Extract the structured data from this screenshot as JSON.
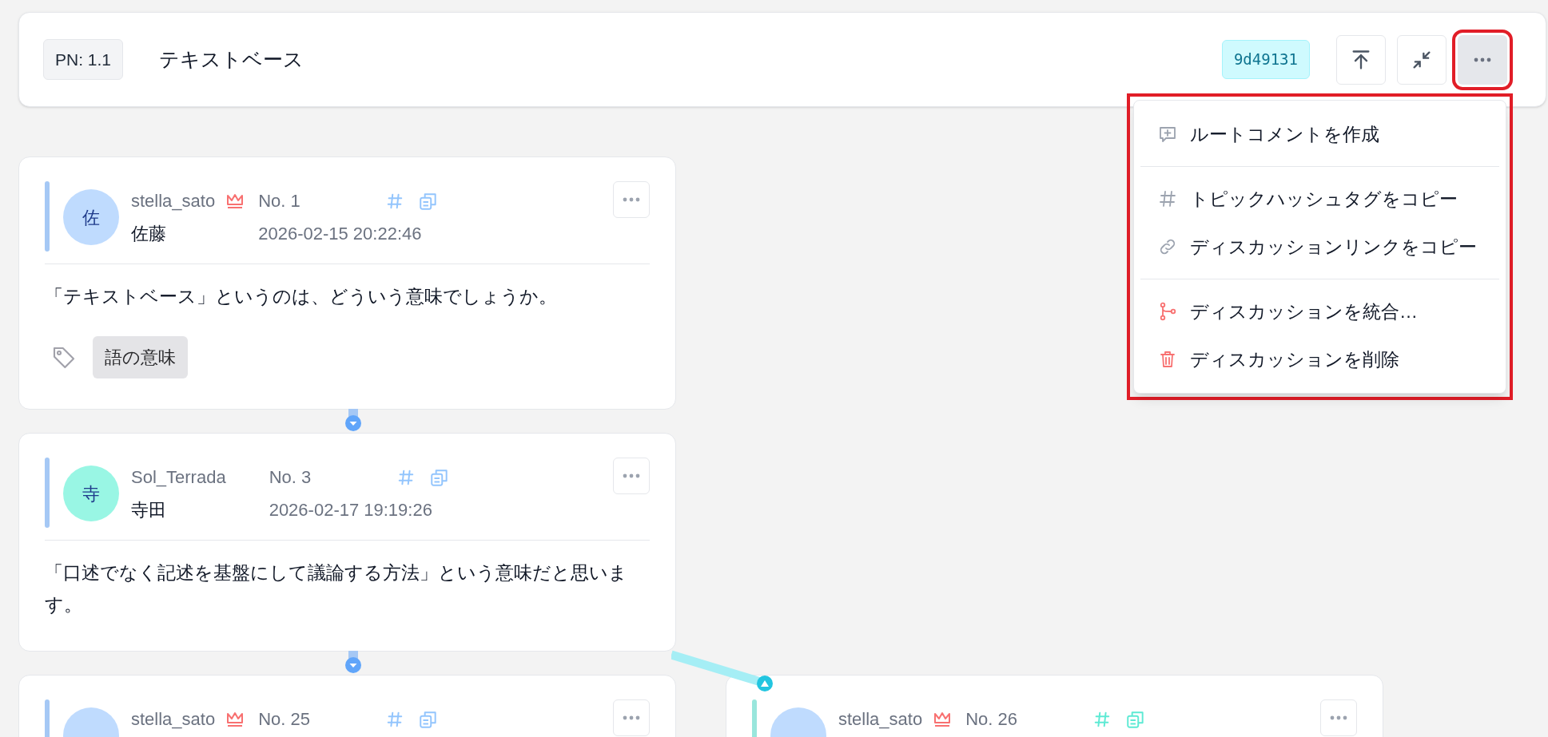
{
  "header": {
    "pn": "PN: 1.1",
    "title": "テキストベース",
    "hash": "9d49131",
    "menu_open": true
  },
  "menu": {
    "groups": [
      [
        {
          "kind": "comment",
          "label": "ルートコメントを作成",
          "danger": false
        }
      ],
      [
        {
          "kind": "hash",
          "label": "トピックハッシュタグをコピー",
          "danger": false
        },
        {
          "kind": "link",
          "label": "ディスカッションリンクをコピー",
          "danger": false
        }
      ],
      [
        {
          "kind": "merge",
          "label": "ディスカッションを統合…",
          "danger": true
        },
        {
          "kind": "trash",
          "label": "ディスカッションを削除",
          "danger": true
        }
      ]
    ]
  },
  "posts": [
    {
      "kind": "main",
      "avatar": "佐",
      "color": "#bfdbfe",
      "username": "stella_sato",
      "crown": true,
      "number": "No. 1",
      "name": "佐藤",
      "date": "2026-02-15 20:22:46",
      "body": "「テキストベース」というのは、どういう意味でしょうか。",
      "tags": [
        "語の意味"
      ]
    },
    {
      "kind": "main",
      "avatar": "寺",
      "color": "#99f6e4",
      "username": "Sol_Terrada",
      "crown": false,
      "number": "No. 3",
      "name": "寺田",
      "date": "2026-02-17 19:19:26",
      "body": "「口述でなく記述を基盤にして議論する方法」という意味だと思います。"
    }
  ],
  "replies": [
    {
      "kind": "main",
      "color": "#bfdbfe",
      "username": "stella_sato",
      "crown": true,
      "number": "No. 25"
    },
    {
      "kind": "branch",
      "color": "#bfdbfe",
      "username": "stella_sato",
      "crown": true,
      "number": "No. 26"
    }
  ]
}
